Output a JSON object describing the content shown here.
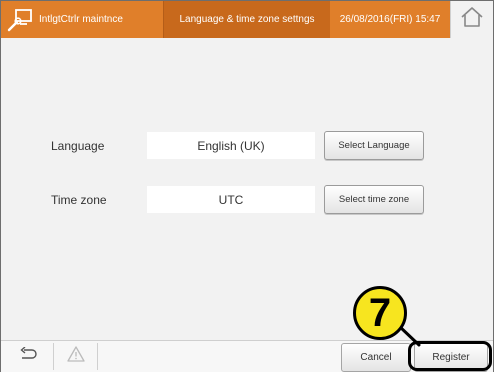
{
  "header": {
    "app_title": "IntlgtCtrlr maintnce",
    "screen_title": "Language & time zone settngs",
    "datetime": "26/08/2016(FRI) 15:47",
    "app_icon": "wrench-monitor-icon",
    "home_icon": "home-icon",
    "accent": "#e07f2a"
  },
  "settings": {
    "language": {
      "label": "Language",
      "value": "English (UK)",
      "button": "Select Language"
    },
    "timezone": {
      "label": "Time zone",
      "value": "UTC",
      "button": "Select time zone"
    }
  },
  "footer": {
    "back_icon": "back-arrow-icon",
    "warning_icon": "warning-icon",
    "cancel_label": "Cancel",
    "register_label": "Register"
  },
  "annotation": {
    "step_number": "7",
    "badge_color": "#f7e51f"
  }
}
